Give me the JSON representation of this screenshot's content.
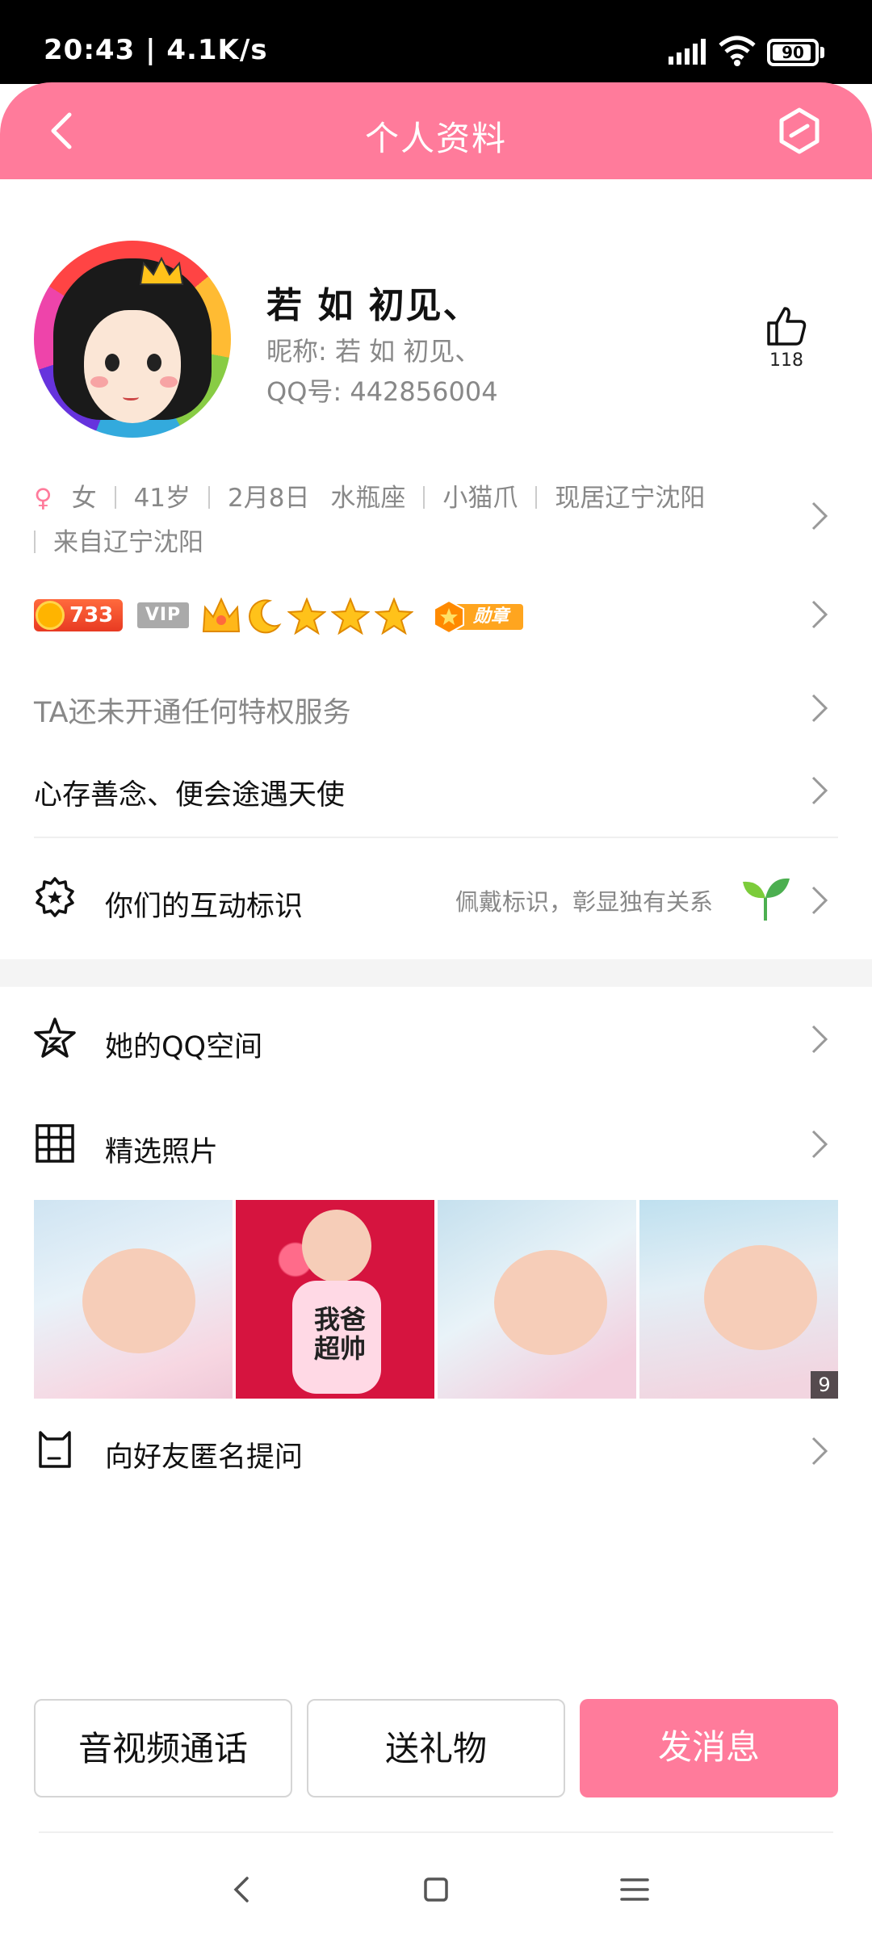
{
  "status_bar": {
    "time": "20:43 | 4.1K/s",
    "battery": "90"
  },
  "header": {
    "title": "个人资料"
  },
  "profile": {
    "name": "若 如 初见、",
    "nickname": "昵称: 若 如 初见、",
    "qq": "QQ号: 442856004",
    "likes": "118"
  },
  "info": {
    "gender": "女",
    "age": "41岁",
    "birthday": "2月8日",
    "zodiac": "水瓶座",
    "tag": "小猫爪",
    "location": "现居辽宁沈阳",
    "hometown": "来自辽宁沈阳"
  },
  "badges": {
    "level": "733",
    "vip": "VIP",
    "medal": "勋章"
  },
  "privilege_text": "TA还未开通任何特权服务",
  "signature": "心存善念、便会途遇天使",
  "interaction": {
    "label": "你们的互动标识",
    "hint": "佩戴标识，彰显独有关系"
  },
  "qzone": {
    "label": "她的QQ空间"
  },
  "photos": {
    "label": "精选照片",
    "onesie_text": "我爸超帅",
    "count": "9"
  },
  "anonymous": {
    "label": "向好友匿名提问"
  },
  "actions": {
    "call": "音视频通话",
    "gift": "送礼物",
    "message": "发消息"
  },
  "colors": {
    "accent": "#ff7b9b",
    "muted": "#888888"
  }
}
